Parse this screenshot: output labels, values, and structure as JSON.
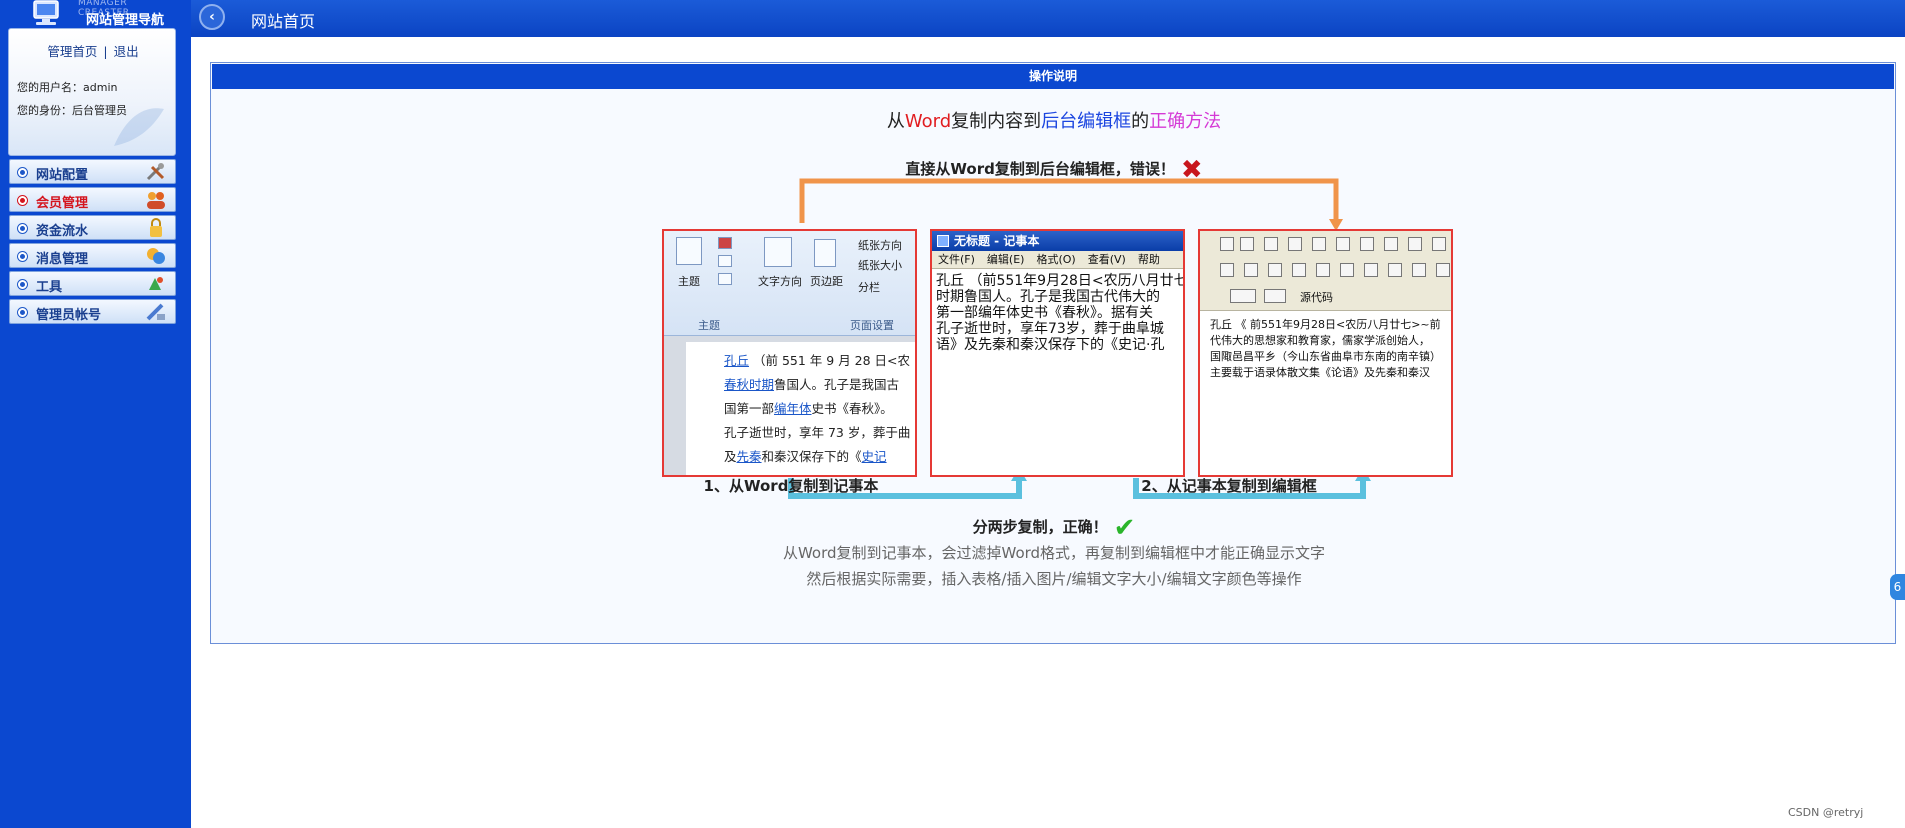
{
  "sidebar": {
    "logo_sub": "MANAGER CREASTER",
    "logo_title": "网站管理导航",
    "links": {
      "home": "管理首页",
      "sep": "|",
      "logout": "退出"
    },
    "user_line": "您的用户名：admin",
    "role_line": "您的身份：后台管理员",
    "items": [
      {
        "label": "网站配置",
        "icon": "tools-icon"
      },
      {
        "label": "会员管理",
        "icon": "users-icon"
      },
      {
        "label": "资金流水",
        "icon": "lock-icon"
      },
      {
        "label": "消息管理",
        "icon": "message-icon"
      },
      {
        "label": "工具",
        "icon": "tool-icon"
      },
      {
        "label": "管理员帐号",
        "icon": "admin-icon"
      }
    ]
  },
  "topbar": {
    "back_label": "‹",
    "title": "网站首页"
  },
  "panel": {
    "header": "操作说明",
    "headline": {
      "p1": "从",
      "p2": "Word",
      "p3": "复制内容到",
      "p4": "后台编辑框",
      "p5": "的",
      "p6": "正确方法"
    },
    "wrong_line": "直接从Word复制到后台编辑框，错误！",
    "wrong_mark": "✖",
    "step1": "1、从Word复制到记事本",
    "step2": "2、从记事本复制到编辑框",
    "right_line": "分两步复制，正确！",
    "right_mark": "✔",
    "desc1": "从Word复制到记事本，会过滤掉Word格式，再复制到编辑框中才能正确显示文字",
    "desc2": "然后根据实际需要，插入表格/插入图片/编辑文字大小/编辑文字颜色等操作"
  },
  "shot1": {
    "btn_theme": "主题",
    "btn_dir": "文字方向",
    "btn_margin": "页边距",
    "btn_paper_dir": "纸张方向",
    "btn_paper_size": "纸张大小",
    "btn_columns": "分栏",
    "grp_theme": "主题",
    "grp_page": "页面设置",
    "l1a": "孔丘",
    "l1b": "（前 551 年 9 月 28 日<农",
    "l2a": "春秋时期",
    "l2b": "鲁国人。孔子是我国古",
    "l3a": "国第一部",
    "l3b": "编年体",
    "l3c": "史书《春秋》。",
    "l4": "孔子逝世时，享年 73 岁，葬于曲",
    "l5a": "及",
    "l5b": "先秦",
    "l5c": "和秦汉保存下的《",
    "l5d": "史记"
  },
  "shot2": {
    "title": "无标题 - 记事本",
    "menu": [
      "文件(F)",
      "编辑(E)",
      "格式(O)",
      "查看(V)",
      "帮助"
    ],
    "lines": [
      "孔丘 （前551年9月28日<农历八月廿七",
      "时期鲁国人。孔子是我国古代伟大的",
      "第一部编年体史书《春秋》。据有关",
      "孔子逝世时，享年73岁，葬于曲阜城",
      "语》及先秦和秦汉保存下的《史记·孔"
    ]
  },
  "shot3": {
    "source_btn": "源代码",
    "lines": [
      "孔丘 《 前551年9月28日<农历八月廿七>~前",
      "代伟大的思想家和教育家，儒家学派创始人，",
      "国陬邑昌平乡（今山东省曲阜市东南的南辛镇）",
      "主要载于语录体散文集《论语》及先秦和秦汉"
    ]
  },
  "sidetab_label": "6",
  "watermark": "CSDN @retryj",
  "colors": {
    "sidebar_bg": "#0b48d0",
    "topbar_bg": "#0b44c3",
    "accent_red": "#e11d21",
    "accent_blue": "#1b45e0",
    "accent_magenta": "#d53ad6",
    "arrow_orange": "#f0944a",
    "arrow_cyan": "#5bc0de",
    "frame_red": "#e53935"
  }
}
